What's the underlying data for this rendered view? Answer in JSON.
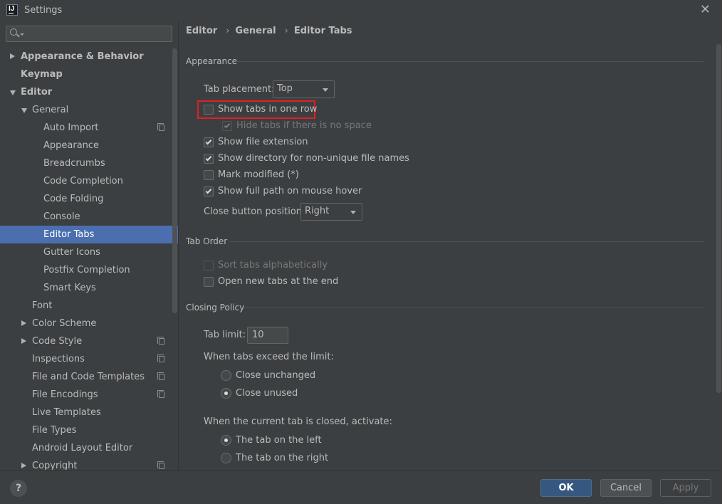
{
  "window": {
    "title": "Settings",
    "app_icon_text": "IJ"
  },
  "sidebar": {
    "search_placeholder": "",
    "items": [
      {
        "label": "Appearance & Behavior",
        "level": 0,
        "bold": true,
        "expander": "collapsed"
      },
      {
        "label": "Keymap",
        "level": 0,
        "bold": true,
        "expander": "none"
      },
      {
        "label": "Editor",
        "level": 0,
        "bold": true,
        "expander": "expanded"
      },
      {
        "label": "General",
        "level": 1,
        "expander": "expanded"
      },
      {
        "label": "Auto Import",
        "level": 2,
        "copy_icon": true
      },
      {
        "label": "Appearance",
        "level": 2
      },
      {
        "label": "Breadcrumbs",
        "level": 2
      },
      {
        "label": "Code Completion",
        "level": 2
      },
      {
        "label": "Code Folding",
        "level": 2
      },
      {
        "label": "Console",
        "level": 2
      },
      {
        "label": "Editor Tabs",
        "level": 2,
        "selected": true
      },
      {
        "label": "Gutter Icons",
        "level": 2
      },
      {
        "label": "Postfix Completion",
        "level": 2
      },
      {
        "label": "Smart Keys",
        "level": 2
      },
      {
        "label": "Font",
        "level": 1
      },
      {
        "label": "Color Scheme",
        "level": 1,
        "expander": "collapsed"
      },
      {
        "label": "Code Style",
        "level": 1,
        "expander": "collapsed",
        "copy_icon": true
      },
      {
        "label": "Inspections",
        "level": 1,
        "copy_icon": true
      },
      {
        "label": "File and Code Templates",
        "level": 1,
        "copy_icon": true
      },
      {
        "label": "File Encodings",
        "level": 1,
        "copy_icon": true
      },
      {
        "label": "Live Templates",
        "level": 1
      },
      {
        "label": "File Types",
        "level": 1
      },
      {
        "label": "Android Layout Editor",
        "level": 1
      },
      {
        "label": "Copyright",
        "level": 1,
        "expander": "collapsed",
        "copy_icon": true
      }
    ]
  },
  "breadcrumb": {
    "items": [
      "Editor",
      "General",
      "Editor Tabs"
    ],
    "separator": "›"
  },
  "appearance": {
    "section_title": "Appearance",
    "tab_placement_label": "Tab placement:",
    "tab_placement_value": "Top",
    "show_tabs_one_row": {
      "label": "Show tabs in one row",
      "checked": false
    },
    "hide_tabs_no_space": {
      "label": "Hide tabs if there is no space",
      "checked": true,
      "disabled": true
    },
    "show_file_extension": {
      "label": "Show file extension",
      "checked": true
    },
    "show_directory": {
      "label": "Show directory for non-unique file names",
      "checked": true
    },
    "mark_modified": {
      "label": "Mark modified (*)",
      "checked": false
    },
    "show_full_path": {
      "label": "Show full path on mouse hover",
      "checked": true
    },
    "close_button_position_label": "Close button position:",
    "close_button_position_value": "Right"
  },
  "tab_order": {
    "section_title": "Tab Order",
    "sort_alphabetically": {
      "label": "Sort tabs alphabetically",
      "checked": false,
      "disabled": true
    },
    "open_at_end": {
      "label": "Open new tabs at the end",
      "checked": false
    }
  },
  "closing_policy": {
    "section_title": "Closing Policy",
    "tab_limit_label": "Tab limit:",
    "tab_limit_value": "10",
    "exceed_label": "When tabs exceed the limit:",
    "close_unchanged": {
      "label": "Close unchanged",
      "selected": false
    },
    "close_unused": {
      "label": "Close unused",
      "selected": true
    },
    "activate_label": "When the current tab is closed, activate:",
    "tab_on_left": {
      "label": "The tab on the left",
      "selected": true
    },
    "tab_on_right": {
      "label": "The tab on the right",
      "selected": false
    }
  },
  "footer": {
    "help_label": "?",
    "ok_label": "OK",
    "cancel_label": "Cancel",
    "apply_label": "Apply"
  },
  "colors": {
    "selection": "#4b6eaf",
    "highlight_border": "#e02020",
    "ok_button": "#365880"
  }
}
